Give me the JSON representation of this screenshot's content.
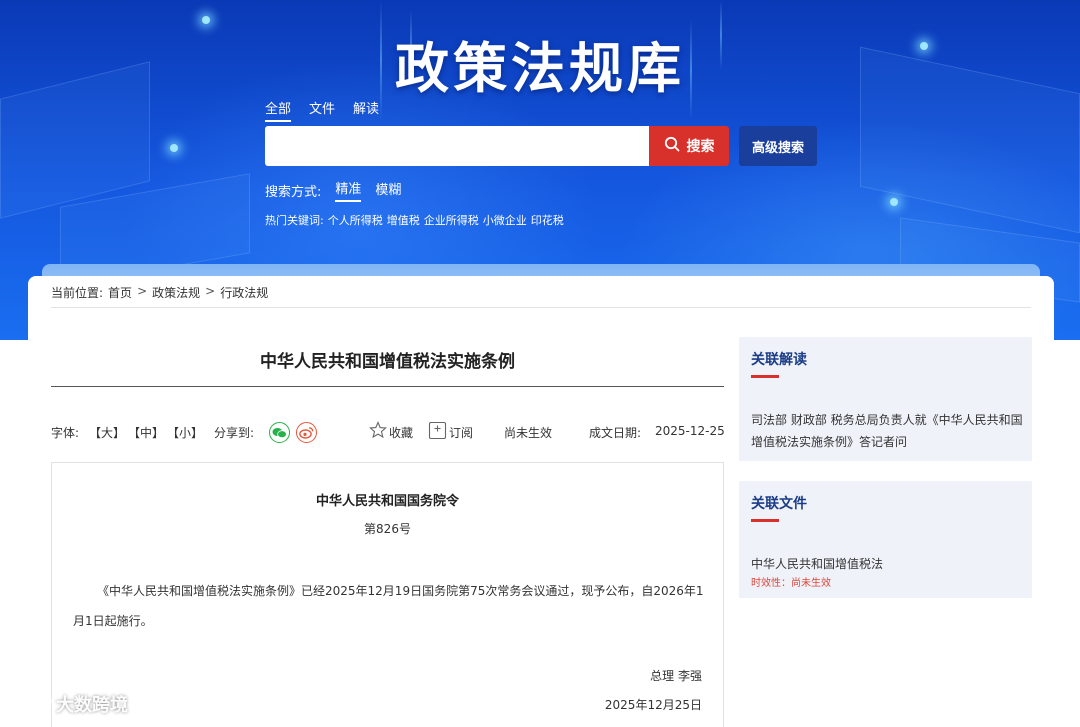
{
  "site": {
    "title": "政策法规库"
  },
  "search": {
    "scope_tabs": [
      "全部",
      "文件",
      "解读"
    ],
    "input_value": "",
    "search_label": "搜索",
    "advanced_label": "高级搜索",
    "mode_label": "搜索方式:",
    "modes": [
      "精准",
      "模糊"
    ],
    "hot_label": "热门关键词:",
    "hot_keywords": [
      "个人所得税",
      "增值税",
      "企业所得税",
      "小微企业",
      "印花税"
    ]
  },
  "breadcrumb": {
    "prefix": "当前位置:",
    "items": [
      "首页",
      "政策法规",
      "行政法规"
    ],
    "separator": ">"
  },
  "document": {
    "title": "中华人民共和国增值税法实施条例",
    "font_label": "字体:",
    "font_sizes": [
      "【大】",
      "【中】",
      "【小】"
    ],
    "share_label": "分享到:",
    "favorite_label": "收藏",
    "subscribe_label": "订阅",
    "status": "尚未生效",
    "date_label": "成文日期:",
    "date_value": "2025-12-25",
    "decree_title": "中华人民共和国国务院令",
    "decree_number": "第826号",
    "body": "《中华人民共和国增值税法实施条例》已经2025年12月19日国务院第75次常务会议通过，现予公布，自2026年1月1日起施行。",
    "signer": "总理 李强",
    "sign_date": "2025年12月25日"
  },
  "sidebar": {
    "related_reading": {
      "heading": "关联解读",
      "items": [
        "司法部 财政部 税务总局负责人就《中华人民共和国增值税法实施条例》答记者问"
      ]
    },
    "related_files": {
      "heading": "关联文件",
      "items": [
        {
          "title": "中华人民共和国增值税法",
          "status": "时效性：尚未生效"
        }
      ]
    }
  },
  "watermark": {
    "text": "大数跨境"
  },
  "colors": {
    "search_red": "#d8312b",
    "advanced_blue": "#1a3e9c",
    "heading_blue": "#1b3c86",
    "sidebar_bg": "#eff3f9",
    "wechat_green": "#27b14a",
    "weibo_orange": "#e4573b"
  },
  "icons": [
    "search-icon",
    "wechat-icon",
    "weibo-icon",
    "star-icon",
    "subscribe-icon",
    "watermark-logo-icon"
  ]
}
